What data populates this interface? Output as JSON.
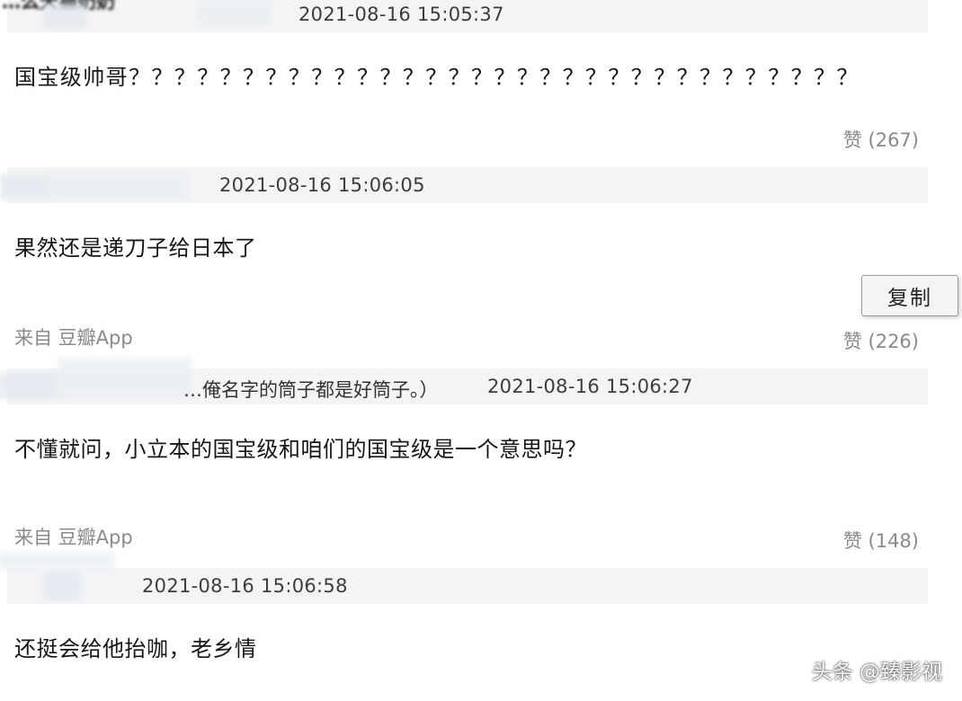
{
  "comments": [
    {
      "username_partial": "…么天猫奶奶",
      "timestamp": "2021-08-16 15:05:37",
      "text": "国宝级帅哥？？？？？？？？？？？？？？？？？？？？？？？？？？？？？？？？",
      "source": "",
      "likes": ""
    },
    {
      "timestamp": "2021-08-16 15:06:05",
      "text": "果然还是递刀子给日本了",
      "source": "来自 豆瓣App",
      "likes": "赞 (267)"
    },
    {
      "quote": "…俺名字的筒子都是好筒子。）",
      "timestamp": "2021-08-16 15:06:27",
      "text": "不懂就问，小立本的国宝级和咱们的国宝级是一个意思吗？",
      "source": "来自 豆瓣App",
      "likes": "赞 (226)"
    },
    {
      "timestamp": "2021-08-16 15:06:58",
      "text": "还挺会给他抬咖，老乡情",
      "source": "",
      "likes": "赞 (148)"
    }
  ],
  "context_menu": {
    "copy_label": "复制"
  },
  "watermark": "头条 @臻影视"
}
